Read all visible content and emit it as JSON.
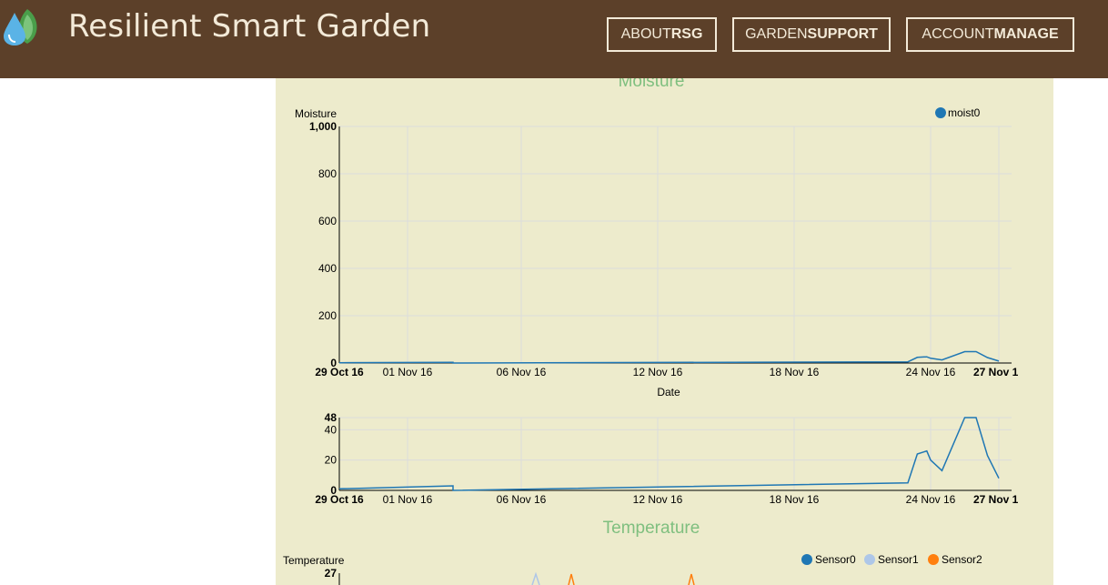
{
  "header": {
    "title": "Resilient Smart Garden",
    "nav": [
      {
        "light": "ABOUT",
        "bold": "RSG"
      },
      {
        "light": "GARDEN",
        "bold": "SUPPORT"
      },
      {
        "light": "ACCOUNT",
        "bold": "MANAGE"
      }
    ],
    "logo_icon": "water-drop-leaf-icon"
  },
  "colors": {
    "header_bg": "#5c4029",
    "panel_bg": "#edebcc",
    "section_title": "#7fbf7f",
    "series_moist0": "#1f77b4",
    "series_sensor0": "#1f77b4",
    "series_sensor1": "#aec7e8",
    "series_sensor2": "#ff7f0e"
  },
  "chart_data": [
    {
      "type": "line",
      "title": "Moisture",
      "ylabel": "Moisture",
      "xlabel": "Date",
      "ylim": [
        0,
        1000
      ],
      "xlim": [
        "2016-10-29",
        "2016-11-27"
      ],
      "yticks": [
        {
          "value": 0,
          "label": "0"
        },
        {
          "value": 200,
          "label": "200"
        },
        {
          "value": 400,
          "label": "400"
        },
        {
          "value": 600,
          "label": "600"
        },
        {
          "value": 800,
          "label": "800"
        },
        {
          "value": 1000,
          "label": "1,000"
        }
      ],
      "xticks": [
        {
          "date": "2016-10-29",
          "label": "29 Oct 16",
          "bold": true
        },
        {
          "date": "2016-11-01",
          "label": "01 Nov 16"
        },
        {
          "date": "2016-11-06",
          "label": "06 Nov 16"
        },
        {
          "date": "2016-11-12",
          "label": "12 Nov 16"
        },
        {
          "date": "2016-11-18",
          "label": "18 Nov 16"
        },
        {
          "date": "2016-11-24",
          "label": "24 Nov 16"
        },
        {
          "date": "2016-11-27",
          "label": "27 Nov 1",
          "bold": true
        }
      ],
      "grid": true,
      "legend": "top-right",
      "series": [
        {
          "name": "moist0",
          "x": [
            "2016-10-29",
            "2016-11-03",
            "2016-11-03",
            "2016-11-23",
            "2016-11-23T10:00",
            "2016-11-23T20:00",
            "2016-11-24",
            "2016-11-24T12:00",
            "2016-11-25T12:00",
            "2016-11-26",
            "2016-11-26T12:00",
            "2016-11-27"
          ],
          "y": [
            1,
            3,
            0,
            5,
            24,
            26,
            20,
            13,
            48,
            48,
            23,
            8
          ]
        }
      ]
    },
    {
      "type": "line",
      "title": "",
      "ylabel": "",
      "xlabel": "",
      "ylim": [
        0,
        48
      ],
      "xlim": [
        "2016-10-29",
        "2016-11-27"
      ],
      "yticks": [
        {
          "value": 0,
          "label": "0"
        },
        {
          "value": 20,
          "label": "20"
        },
        {
          "value": 40,
          "label": "40"
        },
        {
          "value": 48,
          "label": "48"
        }
      ],
      "xticks": [
        {
          "date": "2016-10-29",
          "label": "29 Oct 16",
          "bold": true
        },
        {
          "date": "2016-11-01",
          "label": "01 Nov 16"
        },
        {
          "date": "2016-11-06",
          "label": "06 Nov 16"
        },
        {
          "date": "2016-11-12",
          "label": "12 Nov 16"
        },
        {
          "date": "2016-11-18",
          "label": "18 Nov 16"
        },
        {
          "date": "2016-11-24",
          "label": "24 Nov 16"
        },
        {
          "date": "2016-11-27",
          "label": "27 Nov 1",
          "bold": true
        }
      ],
      "grid": true,
      "series": [
        {
          "name": "moist0",
          "x": [
            "2016-10-29",
            "2016-11-03",
            "2016-11-03",
            "2016-11-23",
            "2016-11-23T10:00",
            "2016-11-23T20:00",
            "2016-11-24",
            "2016-11-24T12:00",
            "2016-11-25T12:00",
            "2016-11-26",
            "2016-11-26T12:00",
            "2016-11-27"
          ],
          "y": [
            1,
            3,
            0,
            5,
            24,
            26,
            20,
            13,
            48,
            48,
            23,
            8
          ]
        }
      ]
    },
    {
      "type": "line",
      "title": "Temperature",
      "ylabel": "Temperature",
      "xlabel": "",
      "ymax_label": "27",
      "legend": "top-right",
      "series": [
        {
          "name": "Sensor0"
        },
        {
          "name": "Sensor1"
        },
        {
          "name": "Sensor2"
        }
      ]
    }
  ]
}
